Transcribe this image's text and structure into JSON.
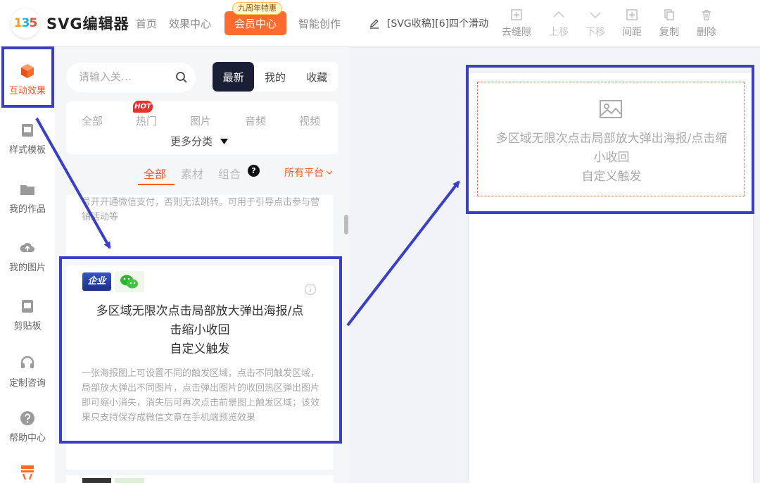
{
  "header": {
    "logo_text": [
      "1",
      "3",
      "5"
    ],
    "app_title": "SVG编辑器",
    "nav": [
      "首页",
      "效果中心",
      "会员中心",
      "智能创作"
    ],
    "vip_badge": "九周年特惠",
    "doc_title": "[SVG收稿][6]四个滑动",
    "tools": [
      "去缝隙",
      "上移",
      "下移",
      "间距",
      "复制",
      "删除"
    ]
  },
  "rail": {
    "items": [
      {
        "label": "互动效果",
        "icon": "cube-icon"
      },
      {
        "label": "样式模板",
        "icon": "template-icon"
      },
      {
        "label": "我的作品",
        "icon": "folder-icon"
      },
      {
        "label": "我的图片",
        "icon": "cloud-upload-icon"
      },
      {
        "label": "剪贴板",
        "icon": "clipboard-icon"
      },
      {
        "label": "定制咨询",
        "icon": "headset-icon"
      },
      {
        "label": "帮助中心",
        "icon": "help-icon"
      }
    ]
  },
  "panel": {
    "search_placeholder": "请输入关…",
    "segments": [
      "最新",
      "我的",
      "收藏"
    ],
    "categories": [
      "全部",
      "热门",
      "图片",
      "音频",
      "视频"
    ],
    "hot_badge": "HOT",
    "more_categories": "更多分类",
    "filters": [
      "全部",
      "素材",
      "组合"
    ],
    "help_glyph": "?",
    "platform": "所有平台",
    "prev_desc": "号开开通微信支付，否则无法跳转。可用于引导点击参与营销活动等",
    "card": {
      "tag_enterprise": "企业",
      "title_lines": [
        "多区域无限次点击局部放大弹出海报/点",
        "击缩小收回",
        "自定义触发"
      ],
      "desc": "一张海报图上可设置不同的触发区域，点击不同触发区域，局部放大弹出不同图片，点击弹出图片的收回热区弹出图片即可缩小消失，消失后可再次点击前景图上触发区域；该效果只支持保存成微信文章在手机端预览效果"
    }
  },
  "canvas": {
    "placeholder_lines": [
      "多区域无限次点击局部放大弹出海报/点击缩",
      "小收回",
      "自定义触发"
    ]
  },
  "colors": {
    "accent": "#ff5a1f",
    "vip": "#ff6b2e",
    "annotation": "#3a3fc8",
    "dark_segment": "#1a1f36"
  }
}
